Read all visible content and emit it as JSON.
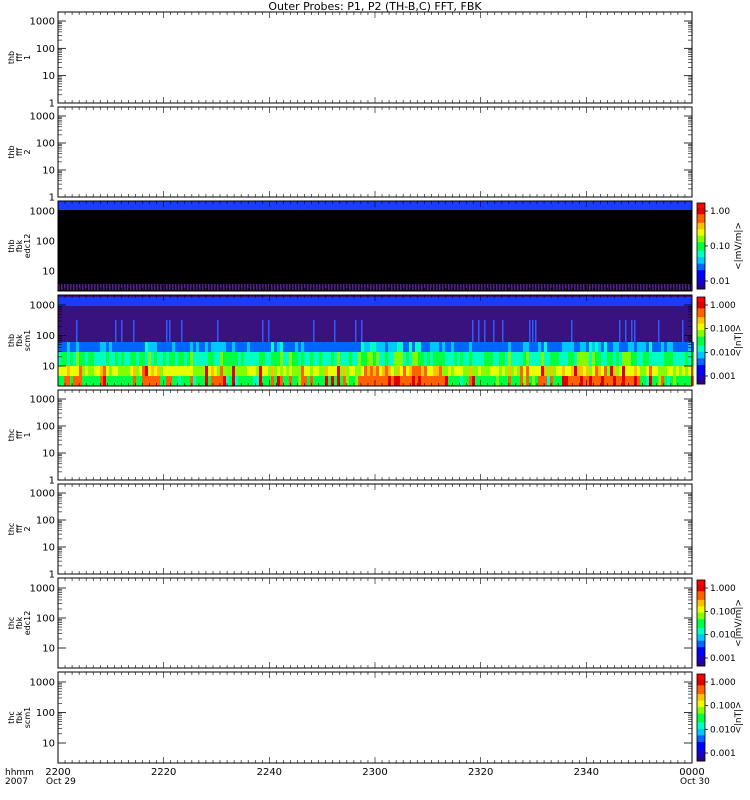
{
  "chart_data": {
    "type": "heatmap",
    "title": "Outer Probes: P1, P2 (TH-B,C) FFT, FBK",
    "x_axis": {
      "ticks": [
        "2200",
        "2220",
        "2240",
        "2300",
        "2320",
        "2340",
        "0000"
      ],
      "row_label_1": "hhmm",
      "row_label_2": "2007",
      "date_left": "Oct 29",
      "date_right": "Oct 30"
    },
    "panels": [
      {
        "label": [
          "thb",
          "fff",
          "1"
        ],
        "yticks": [
          "1",
          "10",
          "100",
          "1000"
        ],
        "colorbar": null
      },
      {
        "label": [
          "thb",
          "fff",
          "2"
        ],
        "yticks": [
          "1",
          "10",
          "100",
          "1000"
        ],
        "colorbar": null
      },
      {
        "label": [
          "thb",
          "fbk",
          "edc12"
        ],
        "yticks": [
          "10",
          "100",
          "1000"
        ],
        "colorbar": {
          "ticks": [
            "0.01",
            "0.10",
            "1.00"
          ],
          "unit": "<|mV/m|>"
        },
        "spectrogram": "black-core"
      },
      {
        "label": [
          "thb",
          "fbk",
          "scm1"
        ],
        "yticks": [
          "10",
          "100",
          "1000"
        ],
        "colorbar": {
          "ticks": [
            "0.001",
            "0.010",
            "0.100",
            "1.000"
          ],
          "unit": "<|nT|>"
        },
        "spectrogram": "rainbow"
      },
      {
        "label": [
          "thc",
          "fff",
          "1"
        ],
        "yticks": [
          "1",
          "10",
          "100",
          "1000"
        ],
        "colorbar": null
      },
      {
        "label": [
          "thc",
          "fff",
          "2"
        ],
        "yticks": [
          "1",
          "10",
          "100",
          "1000"
        ],
        "colorbar": null
      },
      {
        "label": [
          "thc",
          "fbk",
          "edc12"
        ],
        "yticks": [
          "10",
          "100",
          "1000"
        ],
        "colorbar": {
          "ticks": [
            "0.001",
            "0.010",
            "0.100",
            "1.000"
          ],
          "unit": "<|mV/m|>"
        }
      },
      {
        "label": [
          "thc",
          "fbk",
          "scm1"
        ],
        "yticks": [
          "10",
          "100",
          "1000"
        ],
        "colorbar": {
          "ticks": [
            "0.001",
            "0.010",
            "0.100",
            "1.000"
          ],
          "unit": "<|nT|>"
        }
      }
    ]
  }
}
